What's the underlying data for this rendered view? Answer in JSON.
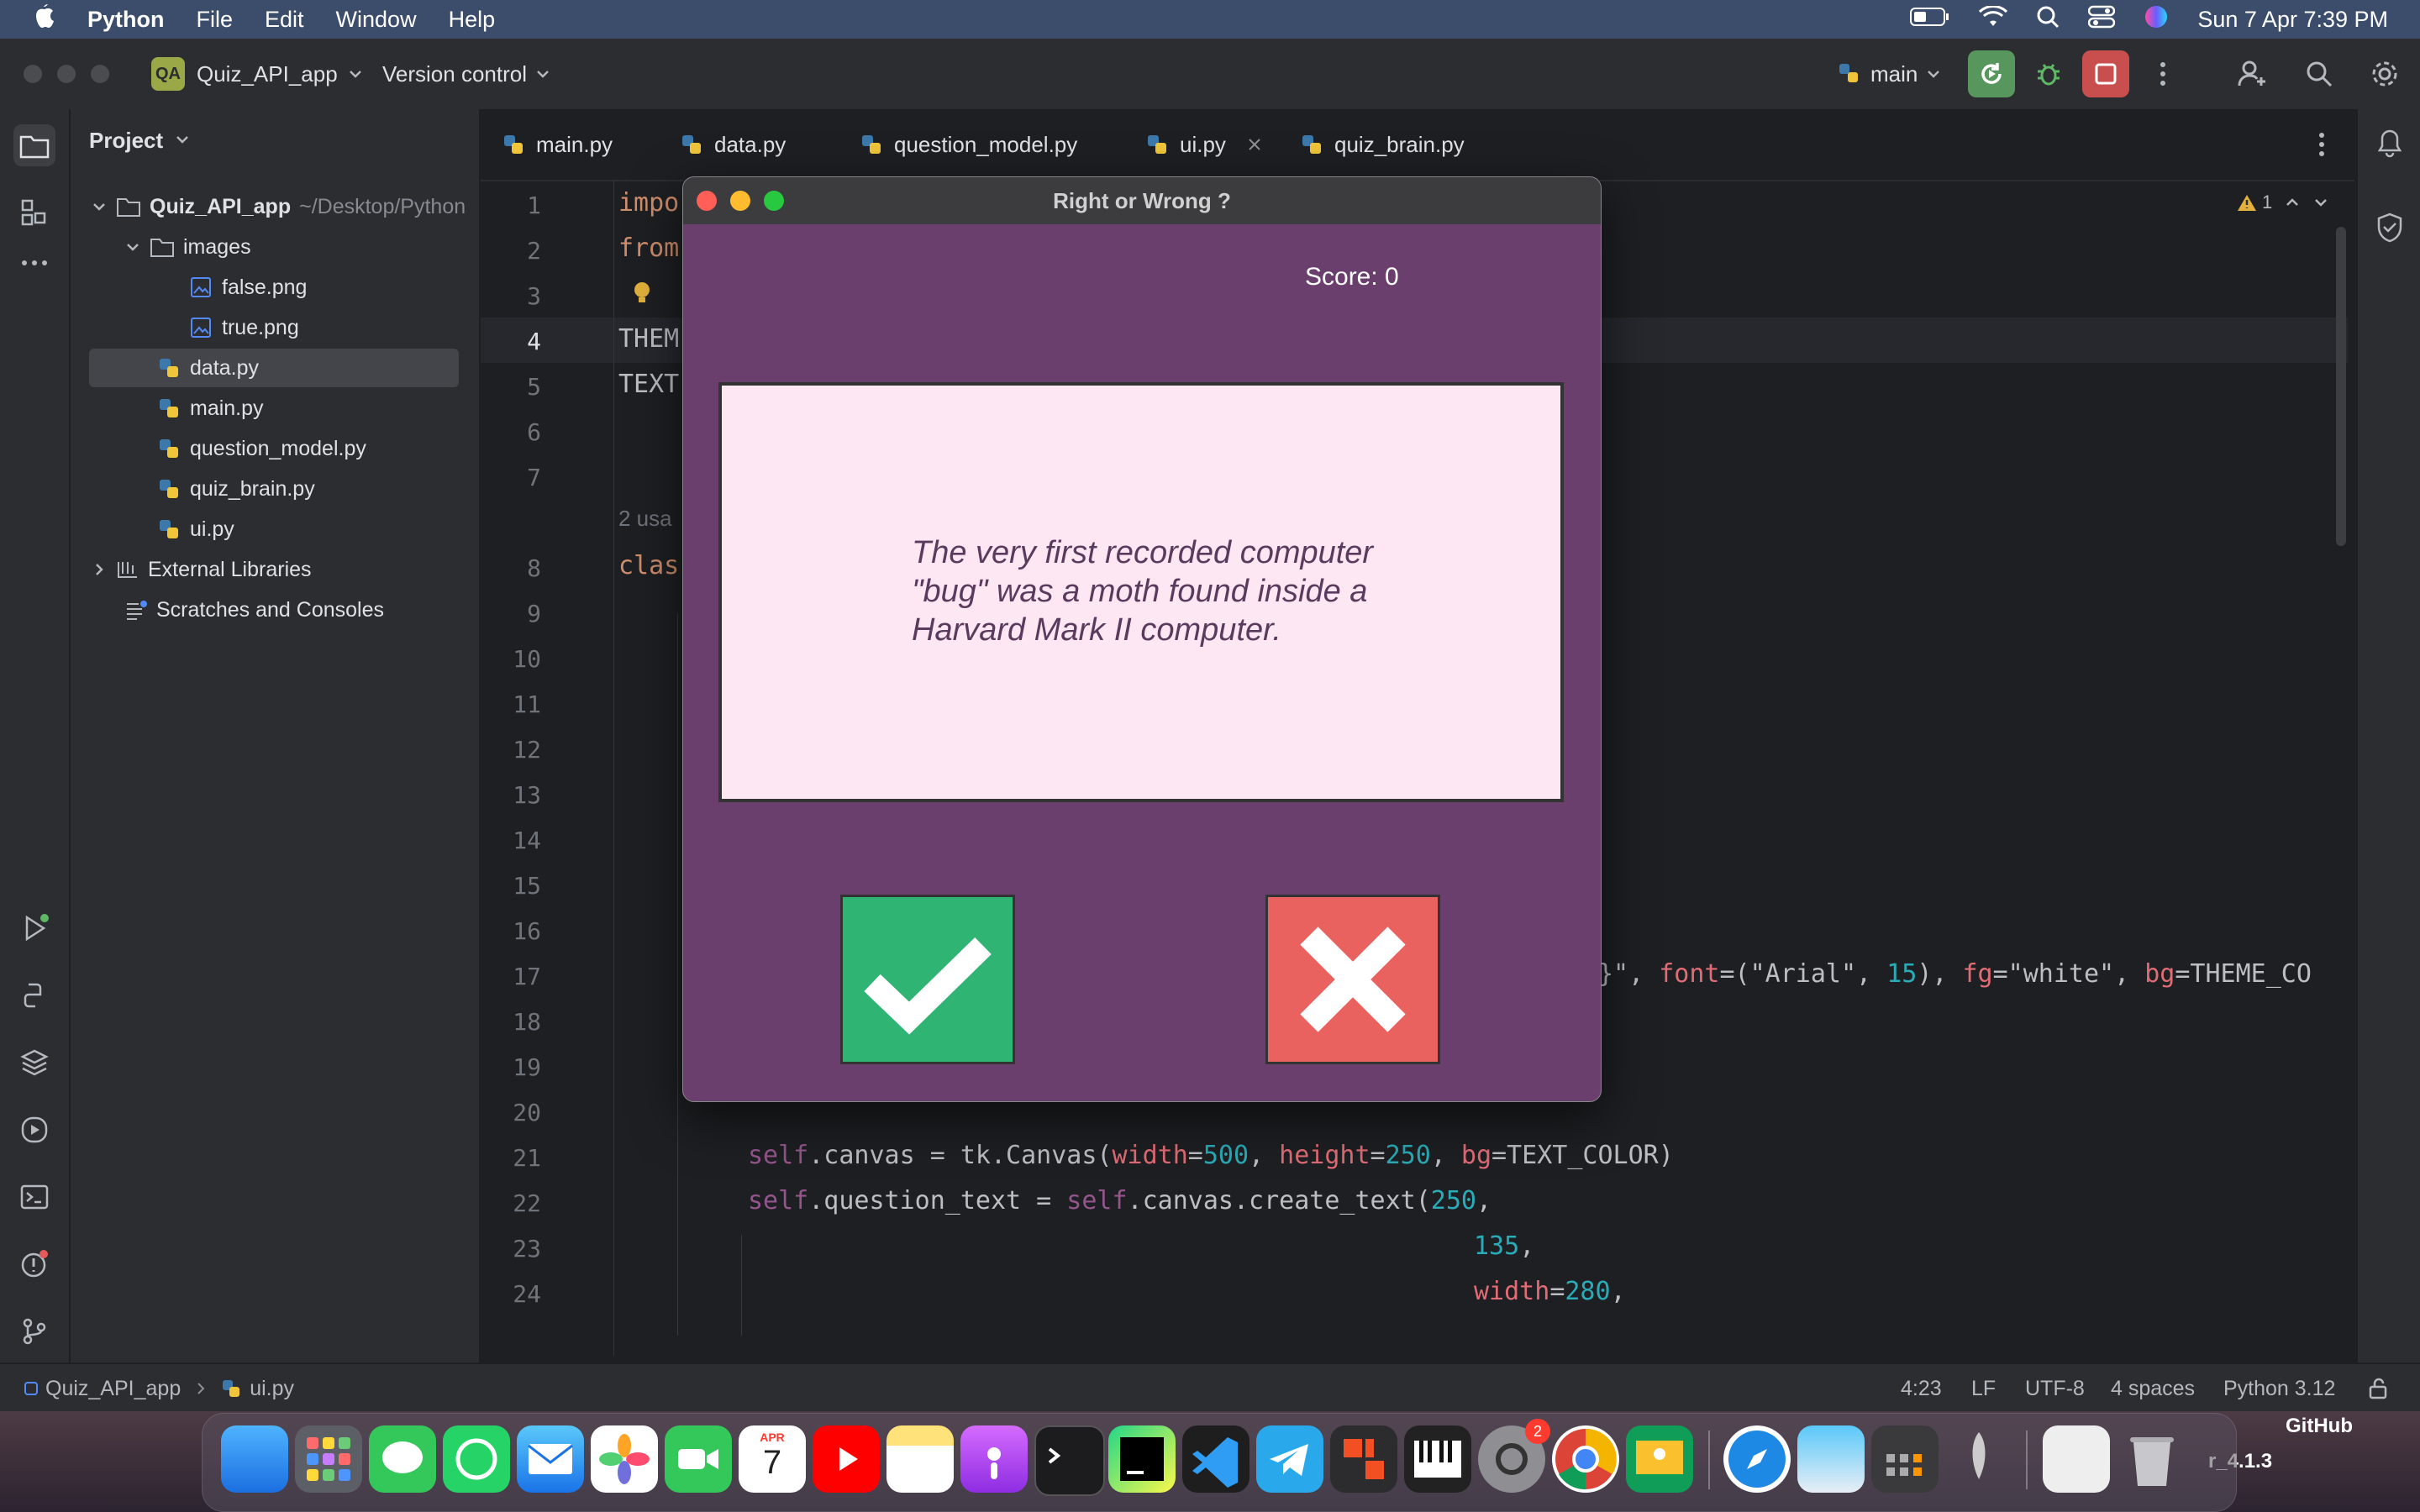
{
  "menubar": {
    "app_name": "Python",
    "items": [
      "File",
      "Edit",
      "Window",
      "Help"
    ],
    "datetime": "Sun 7 Apr  7:39 PM"
  },
  "toolbar": {
    "project_badge": "QA",
    "project_name": "Quiz_API_app",
    "version_control": "Version control",
    "branch": "main"
  },
  "project_panel": {
    "title": "Project",
    "root_name": "Quiz_API_app",
    "root_path": "~/Desktop/Python",
    "images_folder": "images",
    "files": [
      "false.png",
      "true.png",
      "data.py",
      "main.py",
      "question_model.py",
      "quiz_brain.py",
      "ui.py"
    ],
    "external_libraries": "External Libraries",
    "scratches": "Scratches and Consoles"
  },
  "editor": {
    "tabs": [
      "main.py",
      "data.py",
      "question_model.py",
      "ui.py",
      "quiz_brain.py"
    ],
    "active_tab": "ui.py",
    "warning_count": "1",
    "line_numbers": [
      "1",
      "2",
      "3",
      "4",
      "5",
      "6",
      "7",
      "8",
      "9",
      "10",
      "11",
      "12",
      "13",
      "14",
      "15",
      "16",
      "17",
      "18",
      "19",
      "20",
      "21",
      "22",
      "23",
      "24"
    ],
    "code": {
      "l1": "impo",
      "l2": "from",
      "l4": "THEM",
      "l5": "TEXT",
      "usages": "2 usa",
      "l8": "clas",
      "l17_a": "}\", ",
      "l17_font": "font",
      "l17_b": "=(\"Arial\", ",
      "l17_num": "15",
      "l17_c": "), ",
      "l17_fg": "fg",
      "l17_d": "=\"white\", ",
      "l17_bg": "bg",
      "l17_e": "=THEME_CO",
      "l21_self": "self",
      "l21_a": ".canvas = tk.Canvas(",
      "l21_w": "width",
      "l21_eq": "=",
      "l21_wv": "500",
      "l21_sep": ", ",
      "l21_h": "height",
      "l21_hv": "250",
      "l21_bg": "bg",
      "l21_end": "=TEXT_COLOR)",
      "l22_self": "self",
      "l22_a": ".question_text = ",
      "l22_self2": "self",
      "l22_b": ".canvas.create_text(",
      "l22_num": "250",
      "l22_c": ",",
      "l23_num": "135",
      "l23_c": ",",
      "l24_w": "width",
      "l24_eq": "=",
      "l24_num": "280",
      "l24_c": ","
    }
  },
  "statusbar": {
    "breadcrumb_project": "Quiz_API_app",
    "breadcrumb_file": "ui.py",
    "position": "4:23",
    "line_ending": "LF",
    "encoding": "UTF-8",
    "indent": "4 spaces",
    "interpreter": "Python 3.12"
  },
  "dock": {
    "calendar_month": "APR",
    "calendar_day": "7",
    "settings_badge": "2",
    "desktop_label_1": "GitHub",
    "desktop_label_2": "r_4.1.3"
  },
  "dialog": {
    "title": "Right or Wrong ?",
    "score": "Score: 0",
    "question": "The very first recorded computer \"bug\" was a moth found inside a Harvard Mark II computer.",
    "true_color": "#2fb474",
    "false_color": "#e9625f"
  }
}
